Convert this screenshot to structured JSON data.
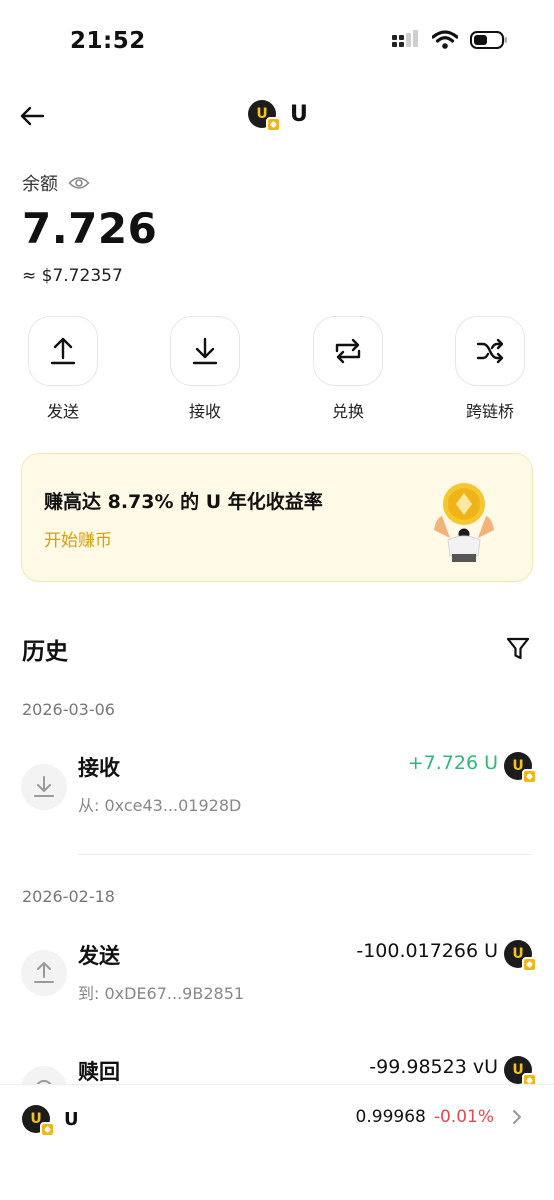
{
  "status_bar": {
    "time": "21:52"
  },
  "header": {
    "token_name": "U",
    "back_icon": "arrow-left-icon"
  },
  "balance": {
    "label": "余额",
    "value": "7.726",
    "fiat": "≈ $7.72357"
  },
  "actions": [
    {
      "label": "发送",
      "icon": "upload-arrow-icon"
    },
    {
      "label": "接收",
      "icon": "download-arrow-icon"
    },
    {
      "label": "兑换",
      "icon": "swap-icon"
    },
    {
      "label": "跨链桥",
      "icon": "shuffle-icon"
    }
  ],
  "promo": {
    "title": "赚高达 8.73% 的 U 年化收益率",
    "link": "开始赚币"
  },
  "history": {
    "title": "历史",
    "groups": [
      {
        "date": "2026-03-06",
        "items": [
          {
            "type": "接收",
            "address": "从: 0xce43...01928D",
            "amount": "+7.726 U"
          }
        ]
      },
      {
        "date": "2026-02-18",
        "items": [
          {
            "type": "发送",
            "address": "到: 0xDE67...9B2851",
            "amount": "-100.017266 U"
          },
          {
            "type": "赎回",
            "address": "",
            "amount": "-99.98523 vU"
          }
        ]
      }
    ]
  },
  "bottom_bar": {
    "token_name": "U",
    "price": "0.99968",
    "change": "-0.01%"
  },
  "colors": {
    "positive": "#2fb87a",
    "negative": "#e5484d",
    "accent": "#d4a10b",
    "promo_bg": "#fff9e6"
  }
}
